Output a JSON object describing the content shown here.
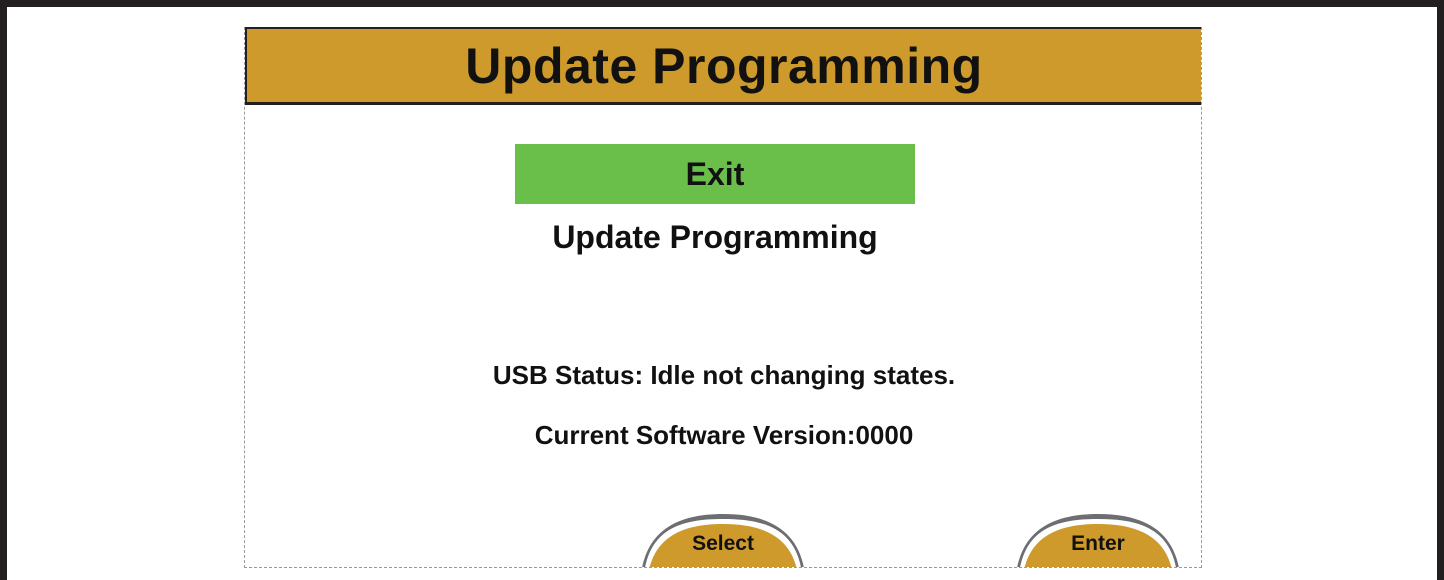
{
  "header": {
    "title": "Update Programming"
  },
  "menu": {
    "exit_label": "Exit",
    "update_label": "Update Programming"
  },
  "status": {
    "usb_status": "USB Status: Idle not changing states.",
    "software_version": "Current Software Version:0000"
  },
  "soft_keys": {
    "select_label": "Select",
    "enter_label": "Enter"
  },
  "colors": {
    "title_bar": "#cd9a2b",
    "highlight": "#6abf4b",
    "soft_key_fill": "#cd9a2b",
    "soft_key_rim": "#6d6e71",
    "frame": "#231f20"
  }
}
